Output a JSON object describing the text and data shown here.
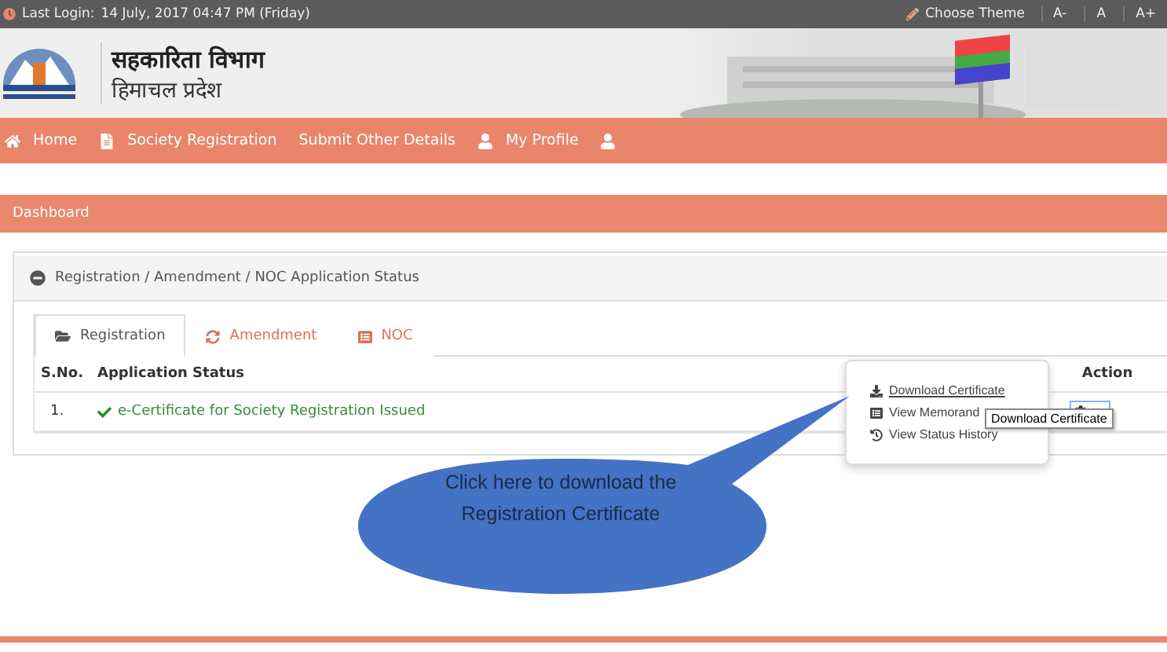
{
  "top_bar": {
    "last_login_label": "Last Login:",
    "last_login_value": "14 July, 2017 04:47 PM (Friday)",
    "theme_button": "Choose Theme",
    "font_sizes": [
      "A-",
      "A",
      "A+"
    ]
  },
  "header": {
    "title": "सहकारिता विभाग",
    "subtitle": "हिमाचल प्रदेश"
  },
  "nav": [
    {
      "label": "Home"
    },
    {
      "label": "Society Registration"
    },
    {
      "label": "Submit Other Details"
    },
    {
      "label": "My Profile"
    }
  ],
  "dashboard": {
    "title": "Dashboard"
  },
  "panel": {
    "title": "Registration / Amendment / NOC Application Status",
    "expanded": true
  },
  "tabs": [
    {
      "label": "Registration",
      "selected": true
    },
    {
      "label": "Amendment",
      "selected": false
    },
    {
      "label": "NOC",
      "selected": false
    }
  ],
  "table": {
    "columns": [
      "S.No.",
      "Application Status",
      "Action"
    ],
    "rows": [
      {
        "sno": "1.",
        "status": "e-Certificate for Society Registration Issued"
      }
    ]
  },
  "menu": [
    {
      "label": "Download Certificate",
      "selected": true
    },
    {
      "label": "View Memorand",
      "selected": false
    },
    {
      "label": "View Status History",
      "selected": false
    }
  ],
  "tooltip": "Download Certificate",
  "callout": "Click here to download the Registration Certificate"
}
